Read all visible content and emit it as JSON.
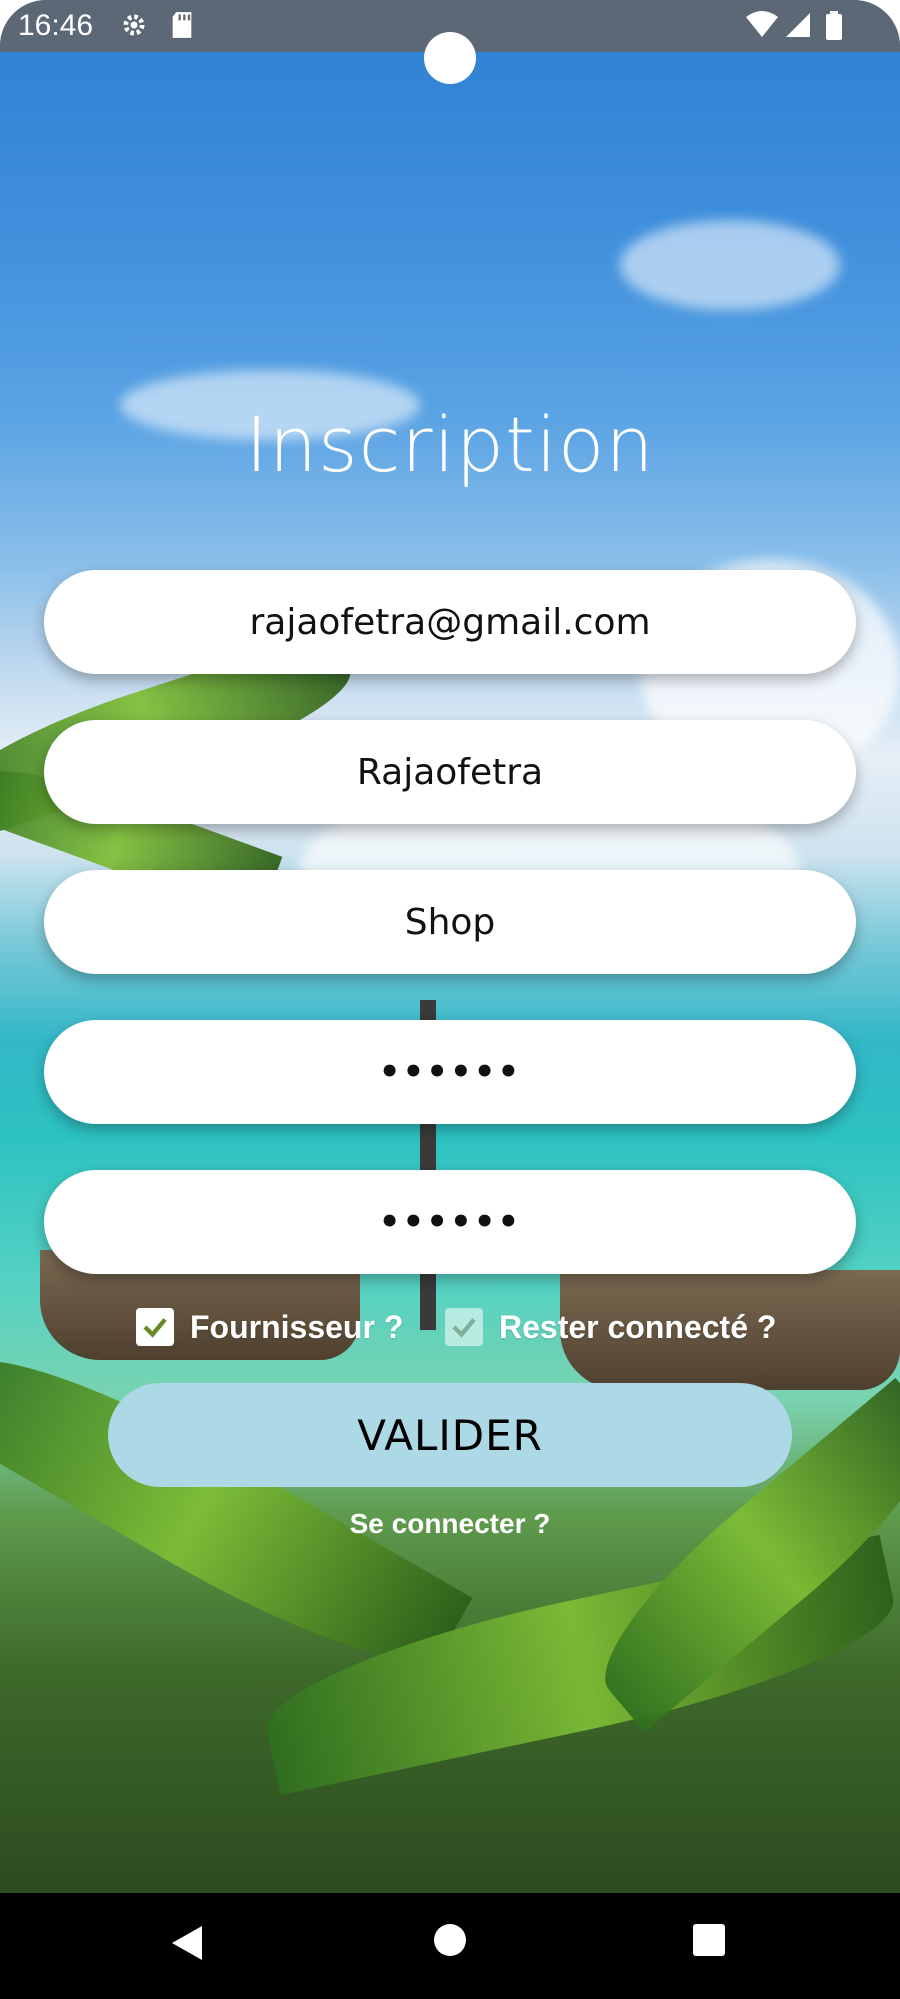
{
  "status_bar": {
    "time": "16:46",
    "icons": [
      "gear-icon",
      "sd-card-icon",
      "wifi-icon",
      "signal-icon",
      "battery-icon"
    ]
  },
  "form": {
    "title": "Inscription",
    "email_value": "rajaofetra@gmail.com",
    "name_value": "Rajaofetra",
    "shop_value": "Shop",
    "password_value": "••••••",
    "confirm_password_value": "••••••"
  },
  "options": {
    "supplier_label": "Fournisseur ?",
    "supplier_checked": true,
    "stay_connected_label": "Rester connecté ?",
    "stay_connected_checked": true
  },
  "actions": {
    "submit_label": "VALIDER",
    "login_link": "Se connecter ?"
  },
  "colors": {
    "submit_button": "#ADD8E6",
    "field_background": "#FFFFFF",
    "nav_bar": "#000000"
  },
  "navigation": {
    "buttons": [
      "back-icon",
      "home-icon",
      "recents-icon"
    ]
  }
}
